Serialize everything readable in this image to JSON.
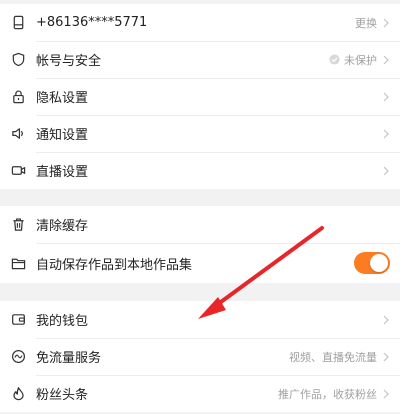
{
  "group1": {
    "phone": {
      "label": "+86136****5771",
      "action": "更换",
      "icon": "phone-icon"
    },
    "account": {
      "label": "帐号与安全",
      "status": "未保护",
      "icon": "shield-icon"
    },
    "privacy": {
      "label": "隐私设置",
      "icon": "lock-icon"
    },
    "notify": {
      "label": "通知设置",
      "icon": "speaker-icon"
    },
    "live": {
      "label": "直播设置",
      "icon": "camera-icon"
    }
  },
  "group2": {
    "cache": {
      "label": "清除缓存",
      "icon": "trash-icon"
    },
    "autosave": {
      "label": "自动保存作品到本地作品集",
      "icon": "folder-icon",
      "enabled": true
    }
  },
  "group3": {
    "wallet": {
      "label": "我的钱包",
      "icon": "wallet-icon"
    },
    "traffic": {
      "label": "免流量服务",
      "hint": "视频、直播免流量",
      "icon": "wave-icon"
    },
    "fans": {
      "label": "粉丝头条",
      "hint": "推广作品，收获粉丝",
      "icon": "fire-icon"
    }
  },
  "colors": {
    "accent": "#fe7c21",
    "annotation_arrow": "#e8262a"
  }
}
